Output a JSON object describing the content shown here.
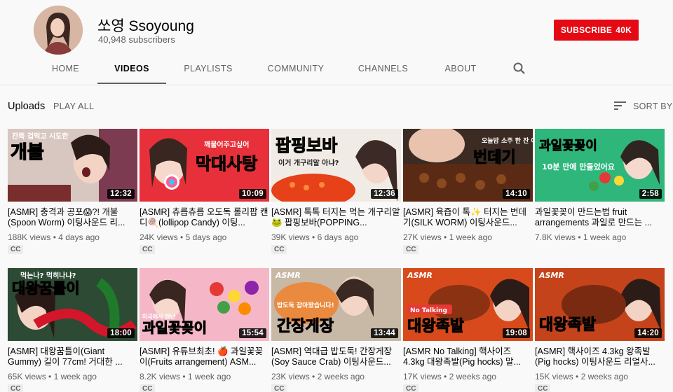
{
  "channel": {
    "name": "쏘영 Ssoyoung",
    "subscribers": "40,948 subscribers",
    "subscribe_label": "SUBSCRIBE",
    "subscribe_count": "40K"
  },
  "tabs": [
    {
      "label": "HOME"
    },
    {
      "label": "VIDEOS"
    },
    {
      "label": "PLAYLISTS"
    },
    {
      "label": "COMMUNITY"
    },
    {
      "label": "CHANNELS"
    },
    {
      "label": "ABOUT"
    }
  ],
  "section": {
    "uploads": "Uploads",
    "play_all": "PLAY ALL",
    "sort_by": "SORT BY"
  },
  "videos": [
    {
      "title": "[ASMR] 충격과 공포😱?! 개불 (Spoon Worm) 이팅사운드 리...",
      "views": "188K views",
      "age": "4 days ago",
      "duration": "12:32",
      "cc": "CC",
      "thumb_text": "개불",
      "thumb_sub": "잔뜩 겁먹고 시도한"
    },
    {
      "title": "[ASMR] 츄릅츄릅 오도독 롤리팝 캔디🍭(lollipop Candy) 이팅...",
      "views": "24K views",
      "age": "5 days ago",
      "duration": "10:09",
      "cc": "CC",
      "thumb_text": "막대사탕",
      "thumb_sub": "깨물어주고싶어"
    },
    {
      "title": "[ASMR] 톡톡 터지는 먹는 개구리알🐸 팝핑보바(POPPING...",
      "views": "39K views",
      "age": "6 days ago",
      "duration": "12:36",
      "cc": "CC",
      "thumb_text": "팝핑보바",
      "thumb_sub": "이거 개구리알 아냐?"
    },
    {
      "title": "[ASMR] 육즙이 톡✨ 터지는 번데기(SILK WORM) 이팅사운드...",
      "views": "27K views",
      "age": "1 week ago",
      "duration": "14:10",
      "cc": "CC",
      "thumb_text": "번데기",
      "thumb_sub": "오늘밤 소주 한 잔 어때요?"
    },
    {
      "title": "과일꽃꽂이 만드는법 fruit arrangements 과일로 만드는 ...",
      "views": "7.8K views",
      "age": "1 week ago",
      "duration": "2:58",
      "cc": "",
      "thumb_text": "과일꽃꽂이",
      "thumb_sub": "10분 만에 만들었어요"
    },
    {
      "title": "[ASMR] 대왕꿈틀이(Giant Gummy) 길이 77cm! 거대한 ...",
      "views": "65K views",
      "age": "1 week ago",
      "duration": "18:00",
      "cc": "CC",
      "thumb_text": "대왕꿈틀이",
      "thumb_sub": "먹는나? 먹히나냐?"
    },
    {
      "title": "[ASMR] 유튜브최초! 🍎 과일꽃꽂이(Fruits arrangement) ASM...",
      "views": "8.2K views",
      "age": "1 week ago",
      "duration": "15:54",
      "cc": "CC",
      "thumb_text": "과일꽃꽂이",
      "thumb_sub": "미국에서 만난"
    },
    {
      "title": "[ASMR] 역대급 밥도둑! 간장게장 (Soy Sauce Crab) 이팅사운드...",
      "views": "23K views",
      "age": "2 weeks ago",
      "duration": "13:44",
      "cc": "CC",
      "thumb_text": "간장게장",
      "thumb_sub": "밥도둑 잡아왔습니다!"
    },
    {
      "title": "[ASMR No Talking] 핵사이즈 4.3kg 대왕족발(Pig hocks) 말...",
      "views": "17K views",
      "age": "2 weeks ago",
      "duration": "19:08",
      "cc": "CC",
      "thumb_text": "대왕족발",
      "thumb_sub": "No Talking"
    },
    {
      "title": "[ASMR] 핵사이즈 4.3kg 왕족발 (Pig hocks) 이팅사운드 리얼사...",
      "views": "15K views",
      "age": "2 weeks ago",
      "duration": "14:20",
      "cc": "CC",
      "thumb_text": "대왕족발",
      "thumb_sub": "ASMR"
    }
  ],
  "colors": {
    "subscribe_red": "#e50914",
    "thumb_yellow": "#ffe600"
  }
}
